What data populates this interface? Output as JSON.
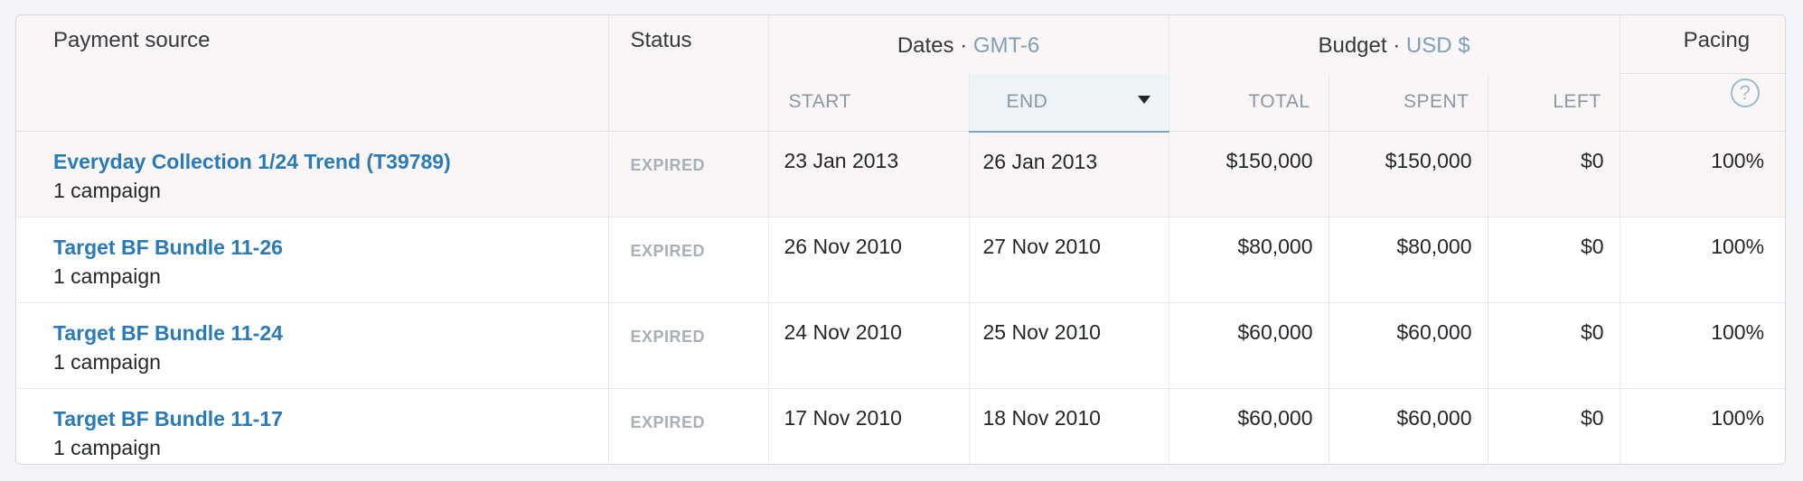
{
  "header": {
    "payment_source": "Payment source",
    "status": "Status",
    "dates": "Dates",
    "dates_tz": "GMT-6",
    "budget": "Budget",
    "budget_currency": "USD $",
    "pacing": "Pacing",
    "sub": {
      "start": "START",
      "end": "END",
      "total": "TOTAL",
      "spent": "SPENT",
      "left": "LEFT"
    },
    "separator": "·",
    "help_glyph": "?"
  },
  "rows": [
    {
      "name": "Everyday Collection 1/24 Trend (T39789)",
      "campaigns": "1 campaign",
      "status": "EXPIRED",
      "start": "23 Jan 2013",
      "end": "26 Jan 2013",
      "total": "$150,000",
      "spent": "$150,000",
      "left": "$0",
      "pacing": "100%"
    },
    {
      "name": "Target BF Bundle 11-26",
      "campaigns": "1 campaign",
      "status": "EXPIRED",
      "start": "26 Nov 2010",
      "end": "27 Nov 2010",
      "total": "$80,000",
      "spent": "$80,000",
      "left": "$0",
      "pacing": "100%"
    },
    {
      "name": "Target BF Bundle 11-24",
      "campaigns": "1 campaign",
      "status": "EXPIRED",
      "start": "24 Nov 2010",
      "end": "25 Nov 2010",
      "total": "$60,000",
      "spent": "$60,000",
      "left": "$0",
      "pacing": "100%"
    },
    {
      "name": "Target BF Bundle 11-17",
      "campaigns": "1 campaign",
      "status": "EXPIRED",
      "start": "17 Nov 2010",
      "end": "18 Nov 2010",
      "total": "$60,000",
      "spent": "$60,000",
      "left": "$0",
      "pacing": "100%"
    }
  ],
  "colors": {
    "link": "#2a7ab8",
    "accent": "#7f9fb8",
    "status_expired": "#a7b0b9",
    "header_bg": "#faf6f5",
    "sorted_column_bg": "#eef3f7"
  },
  "icons": {
    "sort": "caret-down-icon",
    "help": "help-circle-icon"
  }
}
